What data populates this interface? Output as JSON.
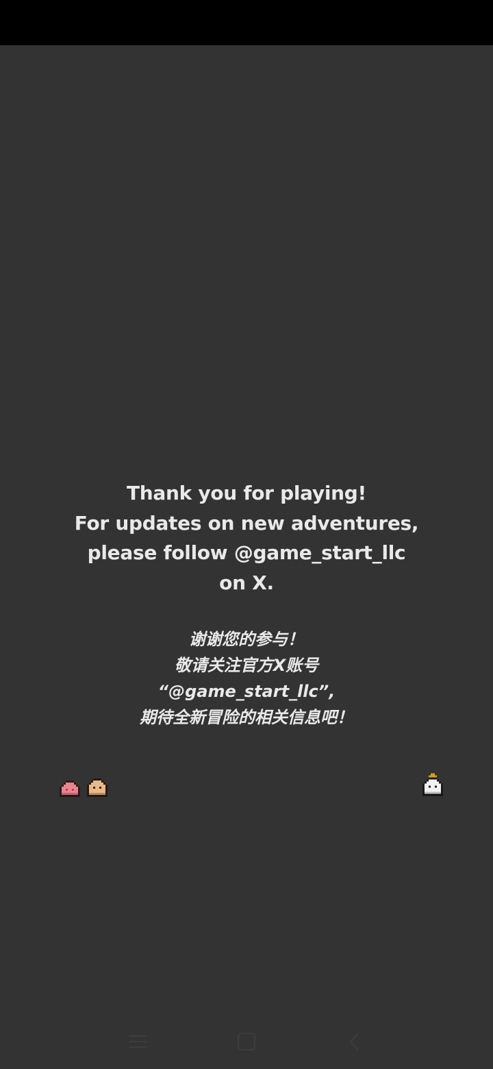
{
  "end_message": {
    "english_lines": [
      "Thank you for playing!",
      "For updates on new adventures,",
      "please follow @game_start_llc",
      "on X."
    ],
    "chinese_lines": [
      "谢谢您的参与！",
      "敬请关注官方X账号",
      "“@game_start_llc”,",
      "期待全新冒险的相关信息吧！"
    ]
  },
  "characters": [
    {
      "name": "pink-slime",
      "color": "#e8848f"
    },
    {
      "name": "tan-character",
      "color": "#e8b98a"
    },
    {
      "name": "white-ghost-with-crown",
      "color": "#f2f2f2"
    }
  ],
  "nav_icons": [
    "menu-icon",
    "home-icon",
    "back-icon"
  ]
}
